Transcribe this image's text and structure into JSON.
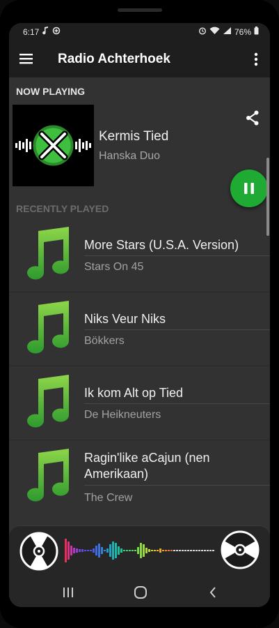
{
  "status_bar": {
    "time": "6:17",
    "battery": "76%",
    "icons": [
      "music-note-icon",
      "data-saver-icon",
      "alarm-icon",
      "wifi-icon",
      "signal-icon",
      "battery-icon"
    ]
  },
  "app_bar": {
    "title": "Radio Achterhoek",
    "icons": [
      "hamburger-menu-icon",
      "more-vert-icon"
    ]
  },
  "now_playing": {
    "section_label": "NOW PLAYING",
    "title": "Kermis Tied",
    "artist": "Hanska Duo",
    "artwork": "radio-achterhoek-logo",
    "actions": [
      "share-icon",
      "pause-icon"
    ]
  },
  "recently_played": {
    "section_label": "RECENTLY PLAYED",
    "items": [
      {
        "title": "More Stars (U.S.A. Version)",
        "artist": "Stars On 45"
      },
      {
        "title": "Niks Veur Niks",
        "artist": "Bökkers"
      },
      {
        "title": "Ik kom Alt op Tied",
        "artist": "De Heikneuters"
      },
      {
        "title": "Ragin'like aCajun (nen Amerikaan)",
        "artist": "The Crew"
      }
    ]
  },
  "colors": {
    "accent_green": "#1faa33",
    "note_green_light": "#8ed64a",
    "note_green_dark": "#2e9a2e",
    "background": "#323232",
    "bars": "#1e1e1e"
  },
  "player_bar": {
    "icons": [
      "vinyl-disc-icon",
      "audio-visualizer",
      "vinyl-disc-icon"
    ]
  },
  "nav_bar": {
    "icons": [
      "recent-apps-icon",
      "home-icon",
      "back-icon"
    ]
  }
}
